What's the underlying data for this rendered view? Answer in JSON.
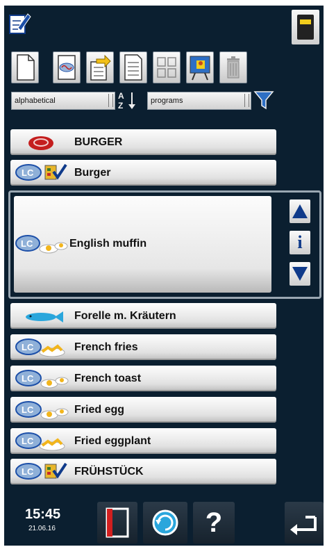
{
  "toolbar": {
    "sort_select_value": "alphabetical",
    "filter_select_value": "programs"
  },
  "list": {
    "items": [
      {
        "label": "BURGER",
        "icon": "steak-icon"
      },
      {
        "label": "Burger",
        "icon": "lc-checklist-icon"
      },
      {
        "label": "English muffin",
        "icon": "lc-eggs-icon"
      },
      {
        "label": "Forelle m. Kräutern",
        "icon": "fish-icon"
      },
      {
        "label": "French fries",
        "icon": "lc-fries-icon"
      },
      {
        "label": "French toast",
        "icon": "lc-eggs-icon"
      },
      {
        "label": "Fried egg",
        "icon": "lc-eggs-icon"
      },
      {
        "label": "Fried eggplant",
        "icon": "lc-fries-icon"
      },
      {
        "label": "FRÜHSTÜCK",
        "icon": "lc-checklist-icon"
      }
    ],
    "selected_index": 2,
    "info_label": "i"
  },
  "footer": {
    "time": "15:45",
    "date": "21.06.16",
    "help_label": "?"
  },
  "colors": {
    "background": "#0b1f30",
    "accent_blue": "#0f3a8a",
    "highlight_yellow": "#f2cd1c"
  }
}
